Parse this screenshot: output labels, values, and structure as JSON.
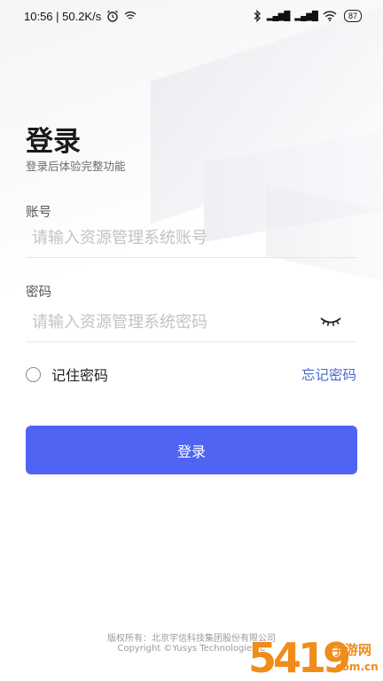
{
  "status_bar": {
    "time_speed": "10:56 | 50.2K/s",
    "battery": "87"
  },
  "login": {
    "title": "登录",
    "subtitle": "登录后体验完整功能",
    "account_label": "账号",
    "account_placeholder": "请输入资源管理系统账号",
    "password_label": "密码",
    "password_placeholder": "请输入资源管理系统密码",
    "remember_label": "记住密码",
    "forgot_label": "忘记密码",
    "login_button": "登录"
  },
  "footer": {
    "line1": "版权所有：北京宇信科技集团股份有限公司",
    "line2": "Copyright ©Yusys Technologies C"
  },
  "watermark": {
    "number": "5419",
    "text": "手游网",
    "domain": ".com.cn"
  },
  "colors": {
    "primary": "#5064f4",
    "link": "#4a68d6",
    "watermark_orange": "#f08c1a"
  }
}
